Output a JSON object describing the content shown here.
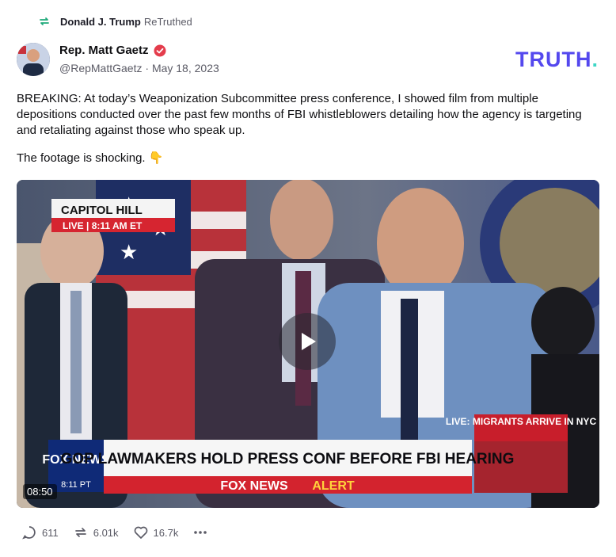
{
  "retruth": {
    "user": "Donald J. Trump",
    "action": "ReTruthed"
  },
  "author": {
    "name": "Rep. Matt Gaetz",
    "handle": "@RepMattGaetz",
    "date": "May 18, 2023",
    "verified": true
  },
  "brand": {
    "text": "TRUTH",
    "dot": "."
  },
  "post": {
    "paragraph1": "BREAKING: At today’s Weaponization Subcommittee press conference, I showed film from multiple depositions conducted over the past few months of FBI whistleblowers detailing how the agency is targeting and retaliating against those who speak up.",
    "paragraph2": "The footage is shocking. 👇"
  },
  "video": {
    "duration": "08:50",
    "overlay": {
      "location": "CAPITOL HILL",
      "live_time": "LIVE | 8:11 AM ET",
      "headline": "GOP LAWMAKERS HOLD PRESS CONF BEFORE FBI HEARING",
      "alert_prefix": "FOX NEWS",
      "alert_word": "ALERT",
      "side_label": "LIVE: MIGRANTS ARRIVE IN NYC",
      "logo": "FOX NEWS",
      "logo_time": "8:11 PT"
    }
  },
  "actions": {
    "replies": "611",
    "retruths": "6.01k",
    "likes": "16.7k"
  },
  "colors": {
    "brand": "#5448ee",
    "brand_dot": "#3dd6c5",
    "verified": "#e43c4c"
  }
}
